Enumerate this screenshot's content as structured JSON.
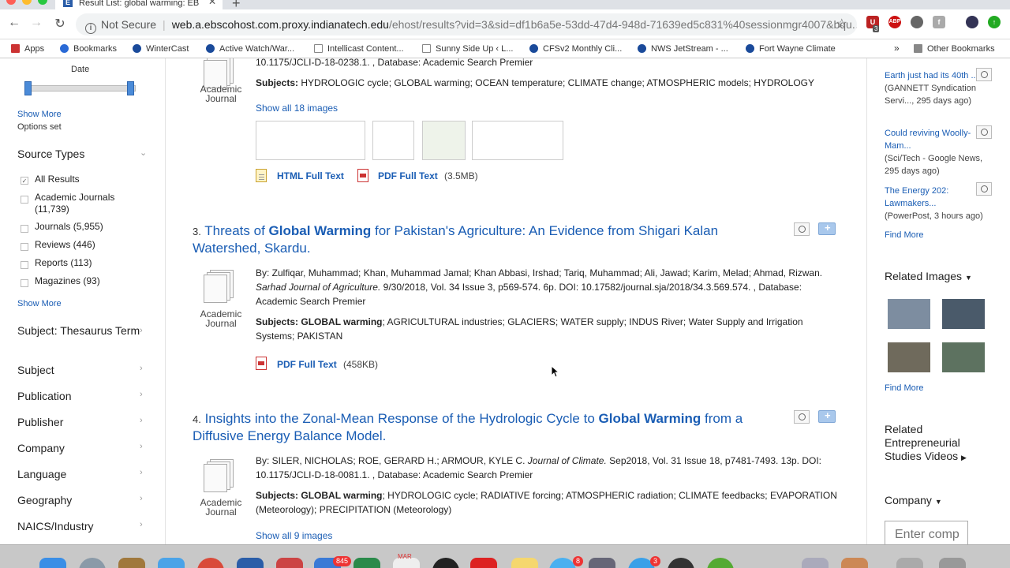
{
  "browser": {
    "tab_title": "Result List: global warming: EB",
    "not_secure": "Not Secure",
    "url_host": "web.a.ebscohost.com.proxy.indianatech.edu",
    "url_path": "/ehost/results?vid=3&sid=df1b6a5e-53dd-47d4-948d-71639ed5c831%40sessionmgr4007&bqu...",
    "bookmarks": [
      "Apps",
      "Bookmarks",
      "WinterCast",
      "Active Watch/War...",
      "Intellicast Content...",
      "Sunny Side Up ‹ L...",
      "CFSv2 Monthly Cli...",
      "NWS JetStream - ...",
      "Fort Wayne Climate"
    ],
    "more_bookmarks": "»",
    "other_bookmarks": "Other Bookmarks",
    "ext_badge": "3",
    "ext_abp": "ABP"
  },
  "sidebar": {
    "date_label": "Date",
    "show_more": "Show More",
    "options_set": "Options set",
    "source_types_title": "Source Types",
    "source_types": [
      {
        "label": "All Results",
        "checked": true
      },
      {
        "label": "Academic Journals (11,739)",
        "checked": false
      },
      {
        "label": "Journals (5,955)",
        "checked": false
      },
      {
        "label": "Reviews (446)",
        "checked": false
      },
      {
        "label": "Reports (113)",
        "checked": false
      },
      {
        "label": "Magazines (93)",
        "checked": false
      }
    ],
    "show_more_2": "Show More",
    "facets": [
      "Subject: Thesaurus Term",
      "Subject",
      "Publication",
      "Publisher",
      "Company",
      "Language",
      "Geography",
      "NAICS/Industry"
    ]
  },
  "results": {
    "r2": {
      "meta_tail": "10.1175/JCLI-D-18-0238.1. , Database: Academic Search Premier",
      "doctype": "Academic Journal",
      "subjects_label": "Subjects:",
      "subjects": "HYDROLOGIC cycle; GLOBAL warming; OCEAN temperature; CLIMATE change; ATMOSPHERIC models; HYDROLOGY",
      "show_images": "Show all 18 images",
      "html_full_text": "HTML Full Text",
      "pdf_full_text": "PDF Full Text",
      "pdf_size": "(3.5MB)"
    },
    "r3": {
      "number": "3.",
      "title_pre": "Threats of",
      "title_bold": "Global Warming",
      "title_post": "for Pakistan's Agriculture: An Evidence from Shigari Kalan Watershed, Skardu.",
      "authors": "By: Zulfiqar, Muhammad; Khan, Muhammad Jamal; Khan Abbasi, Irshad; Tariq, Muhammad; Ali, Jawad; Karim, Melad; Ahmad, Rizwan.",
      "journal": "Sarhad Journal of Agriculture.",
      "citation": "9/30/2018, Vol. 34 Issue 3, p569-574. 6p. DOI: 10.17582/journal.sja/2018/34.3.569.574. , Database: Academic Search Premier",
      "doctype": "Academic Journal",
      "subjects_label": "Subjects:",
      "subjects_bold": "GLOBAL warming",
      "subjects": "; AGRICULTURAL industries; GLACIERS; WATER supply; INDUS River; Water Supply and Irrigation Systems; PAKISTAN",
      "pdf_full_text": "PDF Full Text",
      "pdf_size": "(458KB)"
    },
    "r4": {
      "number": "4.",
      "title_pre": "Insights into the Zonal-Mean Response of the Hydrologic Cycle to",
      "title_bold": "Global Warming",
      "title_post": "from a Diffusive Energy Balance Model.",
      "authors": "By: SILER, NICHOLAS; ROE, GERARD H.; ARMOUR, KYLE C.",
      "journal": "Journal of Climate.",
      "citation": "Sep2018, Vol. 31 Issue 18, p7481-7493. 13p. DOI: 10.1175/JCLI-D-18-0081.1. , Database: Academic Search Premier",
      "doctype": "Academic Journal",
      "subjects_label": "Subjects:",
      "subjects_bold": "GLOBAL warming",
      "subjects": "; HYDROLOGIC cycle; RADIATIVE forcing; ATMOSPHERIC radiation; CLIMATE feedbacks; EVAPORATION (Meteorology); PRECIPITATION (Meteorology)",
      "show_images": "Show all 9 images"
    }
  },
  "right": {
    "news": [
      {
        "title": "Earth just had its 40th ...",
        "meta": "(GANNETT Syndication Servi..., 295 days ago)"
      },
      {
        "title": "Could reviving Woolly-Mam...",
        "meta": "(Sci/Tech - Google News, 295 days ago)"
      },
      {
        "title": "The Energy 202: Lawmakers...",
        "meta": "(PowerPost, 3 hours ago)"
      }
    ],
    "find_more": "Find More",
    "related_images": "Related Images",
    "find_more_2": "Find More",
    "related_videos": "Related Entrepreneurial Studies Videos",
    "company": "Company",
    "company_placeholder": "Enter comp"
  },
  "dock": {
    "badge_mail": "845",
    "badge_cal": "MAR",
    "badge_msg": "8",
    "badge_tw": "3"
  }
}
